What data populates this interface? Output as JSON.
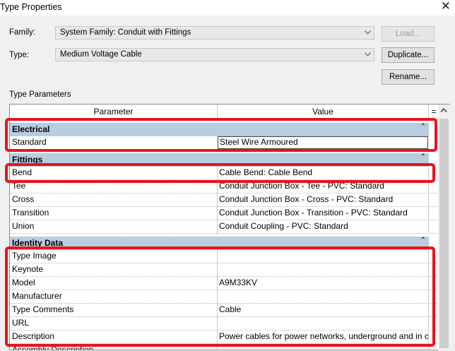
{
  "window": {
    "title": "Type Properties"
  },
  "family": {
    "label": "Family:",
    "value": "System Family: Conduit with Fittings"
  },
  "type": {
    "label": "Type:",
    "value": "Medium Voltage Cable"
  },
  "buttons": {
    "load": "Load...",
    "duplicate": "Duplicate...",
    "rename": "Rename..."
  },
  "section_label": "Type Parameters",
  "columns": {
    "parameter": "Parameter",
    "value": "Value",
    "edit": "="
  },
  "groups": {
    "electrical": "Electrical",
    "fittings": "Fittings",
    "identity": "Identity Data"
  },
  "rows": {
    "standard": {
      "p": "Standard",
      "v": "Steel Wire Armoured"
    },
    "bend": {
      "p": "Bend",
      "v": "Cable Bend: Cable Bend"
    },
    "tee": {
      "p": "Tee",
      "v": "Conduit Junction Box - Tee - PVC: Standard"
    },
    "cross": {
      "p": "Cross",
      "v": "Conduit Junction Box - Cross - PVC: Standard"
    },
    "transition": {
      "p": "Transition",
      "v": "Conduit Junction Box - Transition - PVC: Standard"
    },
    "union": {
      "p": "Union",
      "v": "Conduit Coupling - PVC: Standard"
    },
    "type_image": {
      "p": "Type Image",
      "v": ""
    },
    "keynote": {
      "p": "Keynote",
      "v": ""
    },
    "model": {
      "p": "Model",
      "v": "A9M33KV"
    },
    "manufacturer": {
      "p": "Manufacturer",
      "v": ""
    },
    "type_comments": {
      "p": "Type Comments",
      "v": "Cable"
    },
    "url": {
      "p": "URL",
      "v": ""
    },
    "description": {
      "p": "Description",
      "v": "Power cables for power networks, underground and in c"
    },
    "assembly": {
      "p": "Assembly Description",
      "v": ""
    }
  },
  "colors": {
    "highlight": "#e8141e",
    "group_bg": "#b8cde0"
  }
}
